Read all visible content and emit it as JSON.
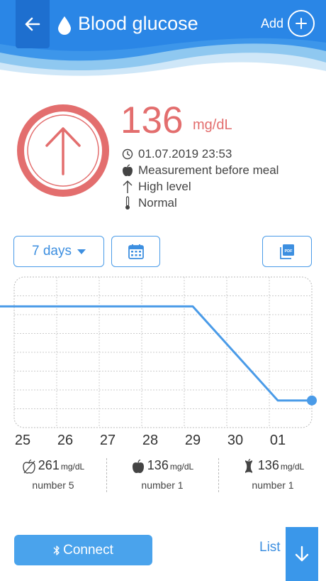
{
  "header": {
    "title": "Blood glucose",
    "add_label": "Add",
    "back_icon": "arrow-left-icon",
    "title_icon": "drop-icon",
    "add_icon": "plus-icon"
  },
  "reading": {
    "value": "136",
    "unit": "mg/dL",
    "datetime": "01.07.2019 23:53",
    "meal": "Measurement before meal",
    "level": "High level",
    "status": "Normal",
    "indicator_icon": "arrow-up-icon",
    "indicator_color": "#e36e6e"
  },
  "controls": {
    "period": "7 days",
    "calendar_icon": "calendar-icon",
    "pdf_icon": "pdf-icon"
  },
  "chart_data": {
    "type": "line",
    "categories": [
      "25",
      "26",
      "27",
      "28",
      "29",
      "30",
      "01"
    ],
    "series": [
      {
        "values": [
          null,
          null,
          null,
          null,
          261,
          null,
          136
        ],
        "color": "#4a9be8"
      }
    ],
    "grid": true
  },
  "stats": [
    {
      "value": "261",
      "unit": "mg/dL",
      "label": "number 5",
      "icon": "apple-outline-icon"
    },
    {
      "value": "136",
      "unit": "mg/dL",
      "label": "number 1",
      "icon": "apple-icon"
    },
    {
      "value": "136",
      "unit": "mg/dL",
      "label": "number 1",
      "icon": "apple-core-icon"
    }
  ],
  "footer": {
    "connect_label": "Connect",
    "connect_icon": "bluetooth-icon",
    "list_label": "List",
    "list_icon": "arrow-down-icon"
  },
  "colors": {
    "header_blue": "#2a86e6",
    "accent_blue": "#4a9be8",
    "alert_red": "#e36e6e"
  }
}
